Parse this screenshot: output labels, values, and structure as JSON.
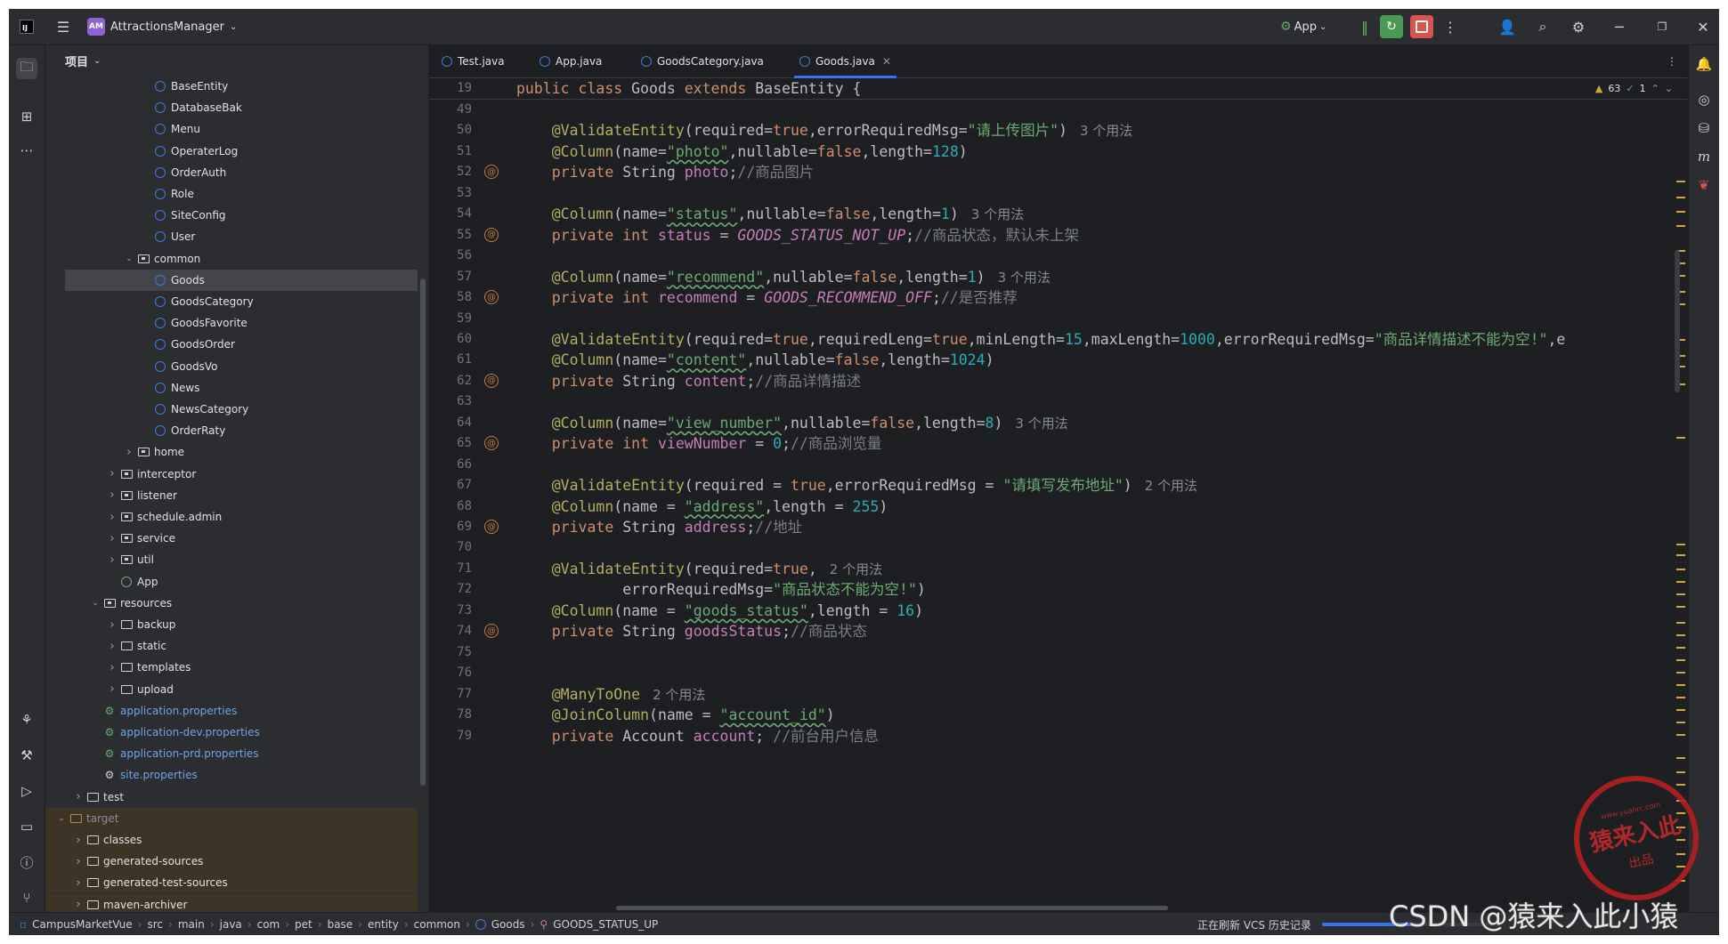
{
  "titlebar": {
    "project_badge": "AM",
    "project_name": "AttractionsManager",
    "run_config": "App"
  },
  "project_panel": {
    "title": "项目",
    "tree": [
      {
        "label": "BaseEntity",
        "type": "class",
        "indent": 5
      },
      {
        "label": "DatabaseBak",
        "type": "class",
        "indent": 5
      },
      {
        "label": "Menu",
        "type": "class",
        "indent": 5
      },
      {
        "label": "OperaterLog",
        "type": "class",
        "indent": 5
      },
      {
        "label": "OrderAuth",
        "type": "class",
        "indent": 5
      },
      {
        "label": "Role",
        "type": "class",
        "indent": 5
      },
      {
        "label": "SiteConfig",
        "type": "class",
        "indent": 5
      },
      {
        "label": "User",
        "type": "class",
        "indent": 5
      },
      {
        "label": "common",
        "type": "package",
        "indent": 4,
        "expanded": true
      },
      {
        "label": "Goods",
        "type": "class",
        "indent": 5,
        "selected": true
      },
      {
        "label": "GoodsCategory",
        "type": "class",
        "indent": 5
      },
      {
        "label": "GoodsFavorite",
        "type": "class",
        "indent": 5
      },
      {
        "label": "GoodsOrder",
        "type": "class",
        "indent": 5
      },
      {
        "label": "GoodsVo",
        "type": "class",
        "indent": 5
      },
      {
        "label": "News",
        "type": "class",
        "indent": 5
      },
      {
        "label": "NewsCategory",
        "type": "class",
        "indent": 5
      },
      {
        "label": "OrderRaty",
        "type": "class",
        "indent": 5
      },
      {
        "label": "home",
        "type": "package",
        "indent": 4,
        "expanded": false
      },
      {
        "label": "interceptor",
        "type": "package",
        "indent": 3,
        "expanded": false
      },
      {
        "label": "listener",
        "type": "package",
        "indent": 3,
        "expanded": false
      },
      {
        "label": "schedule.admin",
        "type": "package",
        "indent": 3,
        "expanded": false
      },
      {
        "label": "service",
        "type": "package",
        "indent": 3,
        "expanded": false
      },
      {
        "label": "util",
        "type": "package",
        "indent": 3,
        "expanded": false
      },
      {
        "label": "App",
        "type": "app",
        "indent": 3
      },
      {
        "label": "resources",
        "type": "resfolder",
        "indent": 2,
        "expanded": true
      },
      {
        "label": "backup",
        "type": "folder",
        "indent": 3,
        "expanded": false
      },
      {
        "label": "static",
        "type": "folder",
        "indent": 3,
        "expanded": false
      },
      {
        "label": "templates",
        "type": "folder",
        "indent": 3,
        "expanded": false
      },
      {
        "label": "upload",
        "type": "folder",
        "indent": 3,
        "expanded": false
      },
      {
        "label": "application.properties",
        "type": "props",
        "indent": 2
      },
      {
        "label": "application-dev.properties",
        "type": "props",
        "indent": 2
      },
      {
        "label": "application-prd.properties",
        "type": "props",
        "indent": 2
      },
      {
        "label": "site.properties",
        "type": "settings",
        "indent": 2
      },
      {
        "label": "test",
        "type": "folder",
        "indent": 1,
        "expanded": false
      },
      {
        "label": "target",
        "type": "target",
        "indent": 0,
        "expanded": true
      },
      {
        "label": "classes",
        "type": "folder",
        "indent": 1,
        "expanded": false
      },
      {
        "label": "generated-sources",
        "type": "folder",
        "indent": 1,
        "expanded": false
      },
      {
        "label": "generated-test-sources",
        "type": "folder",
        "indent": 1,
        "expanded": false
      },
      {
        "label": "maven-archiver",
        "type": "folder",
        "indent": 1,
        "expanded": false
      }
    ]
  },
  "tabs": [
    {
      "label": "Test.java"
    },
    {
      "label": "App.java"
    },
    {
      "label": "GoodsCategory.java"
    },
    {
      "label": "Goods.java",
      "active": true
    }
  ],
  "editor": {
    "sticky_line": "19",
    "sticky_code": "public class Goods extends BaseEntity {",
    "inspections": {
      "warnings": "63",
      "ok": "1"
    },
    "lines": [
      "49",
      "50",
      "51",
      "52",
      "53",
      "54",
      "55",
      "56",
      "57",
      "58",
      "59",
      "60",
      "61",
      "62",
      "63",
      "64",
      "65",
      "66",
      "67",
      "68",
      "69",
      "70",
      "71",
      "72",
      "73",
      "74",
      "75",
      "76",
      "77",
      "78",
      "79"
    ],
    "annotated_lines": [
      "52",
      "55",
      "58",
      "62",
      "65",
      "69",
      "74"
    ],
    "hints": {
      "l50": "3 个用法",
      "l54": "3 个用法",
      "l57": "3 个用法",
      "l64": "3 个用法",
      "l67": "2 个用法",
      "l71": "2 个用法",
      "l77": "2 个用法"
    },
    "code": {
      "l50a": "@ValidateEntity",
      "l50b": "(required=",
      "l50c": "true",
      "l50d": ",errorRequiredMsg=",
      "l50e": "\"请上传图片\"",
      "l50f": ")",
      "l51a": "@Column",
      "l51b": "(name=",
      "l51c": "\"photo\"",
      "l51d": ",nullable=",
      "l51e": "false",
      "l51f": ",length=",
      "l51g": "128",
      "l51h": ")",
      "l52a": "private ",
      "l52b": "String ",
      "l52c": "photo",
      "l52d": ";",
      "l52e": "//商品图片",
      "l54a": "@Column",
      "l54b": "(name=",
      "l54c": "\"status\"",
      "l54d": ",nullable=",
      "l54e": "false",
      "l54f": ",length=",
      "l54g": "1",
      "l54h": ")",
      "l55a": "private int ",
      "l55b": "status",
      "l55c": " = ",
      "l55d": "GOODS_STATUS_NOT_UP",
      "l55e": ";",
      "l55f": "//商品状态，默认未上架",
      "l57a": "@Column",
      "l57b": "(name=",
      "l57c": "\"recommend\"",
      "l57d": ",nullable=",
      "l57e": "false",
      "l57f": ",length=",
      "l57g": "1",
      "l57h": ")",
      "l58a": "private int ",
      "l58b": "recommend",
      "l58c": " = ",
      "l58d": "GOODS_RECOMMEND_OFF",
      "l58e": ";",
      "l58f": "//是否推荐",
      "l60a": "@ValidateEntity",
      "l60b": "(required=",
      "l60c": "true",
      "l60d": ",requiredLeng=",
      "l60e": "true",
      "l60f": ",minLength=",
      "l60g": "15",
      "l60h": ",maxLength=",
      "l60i": "1000",
      "l60j": ",errorRequiredMsg=",
      "l60k": "\"商品详情描述不能为空!\"",
      "l60l": ",e",
      "l61a": "@Column",
      "l61b": "(name=",
      "l61c": "\"content\"",
      "l61d": ",nullable=",
      "l61e": "false",
      "l61f": ",length=",
      "l61g": "1024",
      "l61h": ")",
      "l62a": "private ",
      "l62b": "String ",
      "l62c": "content",
      "l62d": ";",
      "l62e": "//商品详情描述",
      "l64a": "@Column",
      "l64b": "(name=",
      "l64c": "\"view_number\"",
      "l64d": ",nullable=",
      "l64e": "false",
      "l64f": ",length=",
      "l64g": "8",
      "l64h": ")",
      "l65a": "private int ",
      "l65b": "viewNumber",
      "l65c": " = ",
      "l65d": "0",
      "l65e": ";",
      "l65f": "//商品浏览量",
      "l67a": "@ValidateEntity",
      "l67b": "(required = ",
      "l67c": "true",
      "l67d": ",errorRequiredMsg = ",
      "l67e": "\"请填写发布地址\"",
      "l67f": ")",
      "l68a": "@Column",
      "l68b": "(name = ",
      "l68c": "\"address\"",
      "l68d": ",length = ",
      "l68e": "255",
      "l68f": ")",
      "l69a": "private ",
      "l69b": "String ",
      "l69c": "address",
      "l69d": ";",
      "l69e": "//地址",
      "l71a": "@ValidateEntity",
      "l71b": "(required=",
      "l71c": "true",
      "l71d": ",",
      "l72a": "        errorRequiredMsg=",
      "l72b": "\"商品状态不能为空!\"",
      "l72c": ")",
      "l73a": "@Column",
      "l73b": "(name = ",
      "l73c": "\"goods_status\"",
      "l73d": ",length = ",
      "l73e": "16",
      "l73f": ")",
      "l74a": "private ",
      "l74b": "String ",
      "l74c": "goodsStatus",
      "l74d": ";",
      "l74e": "//商品状态",
      "l77a": "@ManyToOne",
      "l78a": "@JoinColumn",
      "l78b": "(name = ",
      "l78c": "\"account_id\"",
      "l78d": ")",
      "l79a": "private ",
      "l79b": "Account ",
      "l79c": "account",
      "l79d": "; ",
      "l79e": "//前台用户信息"
    }
  },
  "statusbar": {
    "crumbs": [
      "CampusMarketVue",
      "src",
      "main",
      "java",
      "com",
      "pet",
      "base",
      "entity",
      "common",
      "Goods",
      "GOODS_STATUS_UP"
    ],
    "task_text": "正在刷新 VCS 历史记录",
    "progress": 0.5
  },
  "watermark": {
    "stamp_big": "猿来入此",
    "stamp_small": "出品",
    "stamp_url": "www.yuanrc.com",
    "csdn": "CSDN @猿来入此小猿"
  },
  "colors": {
    "accent": "#3574f0",
    "keyword": "#cf8e6d",
    "annotation": "#b3ae60",
    "string": "#6aab73",
    "number": "#2aacb8",
    "comment": "#7a7e85",
    "constant": "#c77dbb"
  }
}
